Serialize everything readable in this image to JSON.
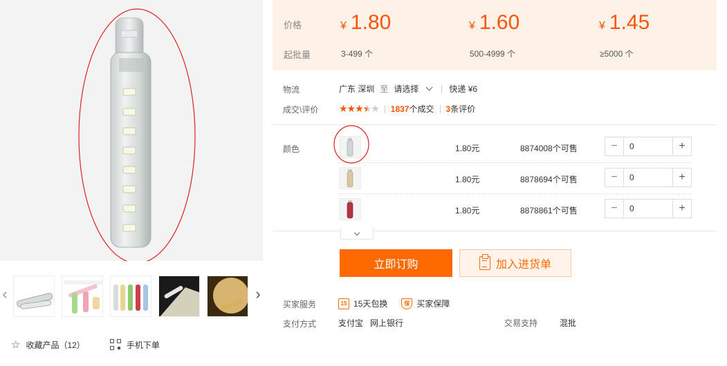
{
  "price_tiers": {
    "price_label": "价格",
    "qty_label": "起批量",
    "currency": "¥",
    "tiers": [
      {
        "price": "1.80",
        "range": "3-499 个"
      },
      {
        "price": "1.60",
        "range": "500-4999 个"
      },
      {
        "price": "1.45",
        "range": "≥5000 个"
      }
    ]
  },
  "logistics": {
    "label": "物流",
    "from": "广东 深圳",
    "to_word": "至",
    "select": "请选择",
    "express": "快递 ¥6"
  },
  "deal": {
    "label": "成交\\评价",
    "rating": 3.5,
    "deals_count": "1837",
    "deals_suffix": "个成交",
    "reviews_count": "3",
    "reviews_suffix": "条评价"
  },
  "sku": {
    "label": "颜色",
    "rows": [
      {
        "price": "1.80元",
        "stock": "8874008个可售",
        "qty": "0",
        "color": "#cfd6d4"
      },
      {
        "price": "1.80元",
        "stock": "8878694个可售",
        "qty": "0",
        "color": "#d9c9a6"
      },
      {
        "price": "1.80元",
        "stock": "8878861个可售",
        "qty": "0",
        "color": "#b0363d"
      }
    ]
  },
  "actions": {
    "order": "立即订购",
    "cart": "加入进货单"
  },
  "services": {
    "label": "买家服务",
    "items": [
      {
        "icon": "15",
        "text": "15天包换"
      },
      {
        "icon": "保",
        "text": "买家保障"
      }
    ]
  },
  "payment": {
    "label": "支付方式",
    "methods": [
      "支付宝",
      "网上银行"
    ],
    "trade_label": "交易支持",
    "trade_value": "混批"
  },
  "gallery": {
    "favorite": "收藏产品（12）",
    "mobile": "手机下单"
  },
  "colors": {
    "accent": "#ff6a00",
    "price": "#ff5500",
    "band": "#fdf1e8"
  }
}
